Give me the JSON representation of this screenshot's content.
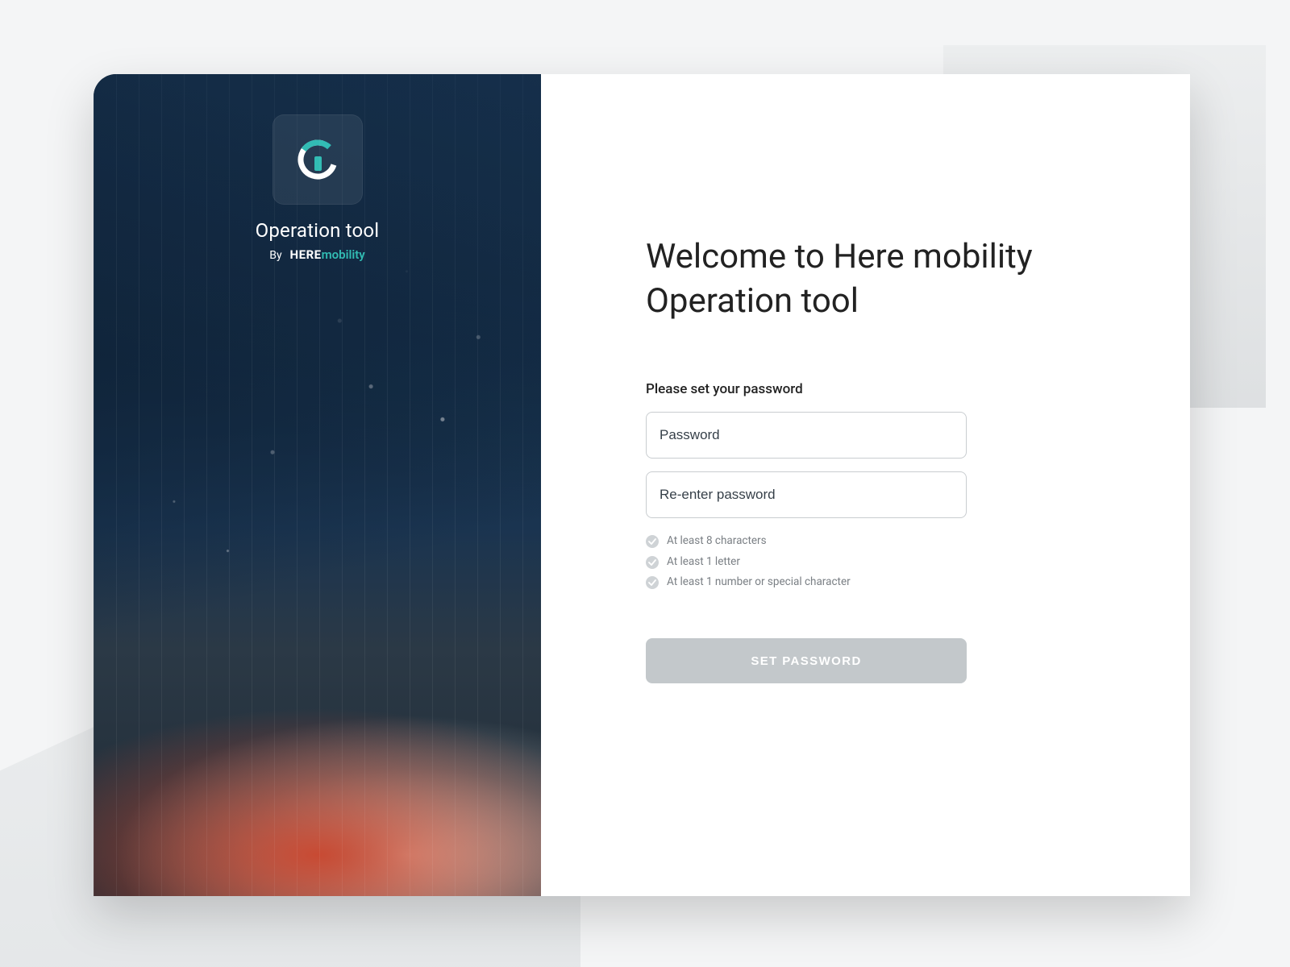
{
  "brand": {
    "title": "Operation tool",
    "by": "By",
    "here": "HERE",
    "mobility": "mobility",
    "accent_color": "#2fbab0"
  },
  "panel": {
    "welcome_line1": "Welcome to Here mobility",
    "welcome_line2": "Operation tool",
    "instruction": "Please set your password",
    "password_placeholder": "Password",
    "reenter_placeholder": "Re-enter password",
    "rules": [
      "At least 8 characters",
      "At least 1 letter",
      "At least 1 number or special character"
    ],
    "submit_label": "SET PASSWORD"
  },
  "colors": {
    "button_disabled_bg": "#c3c8cb",
    "input_border": "#c9cdd0",
    "rule_text": "#7a7f84"
  }
}
